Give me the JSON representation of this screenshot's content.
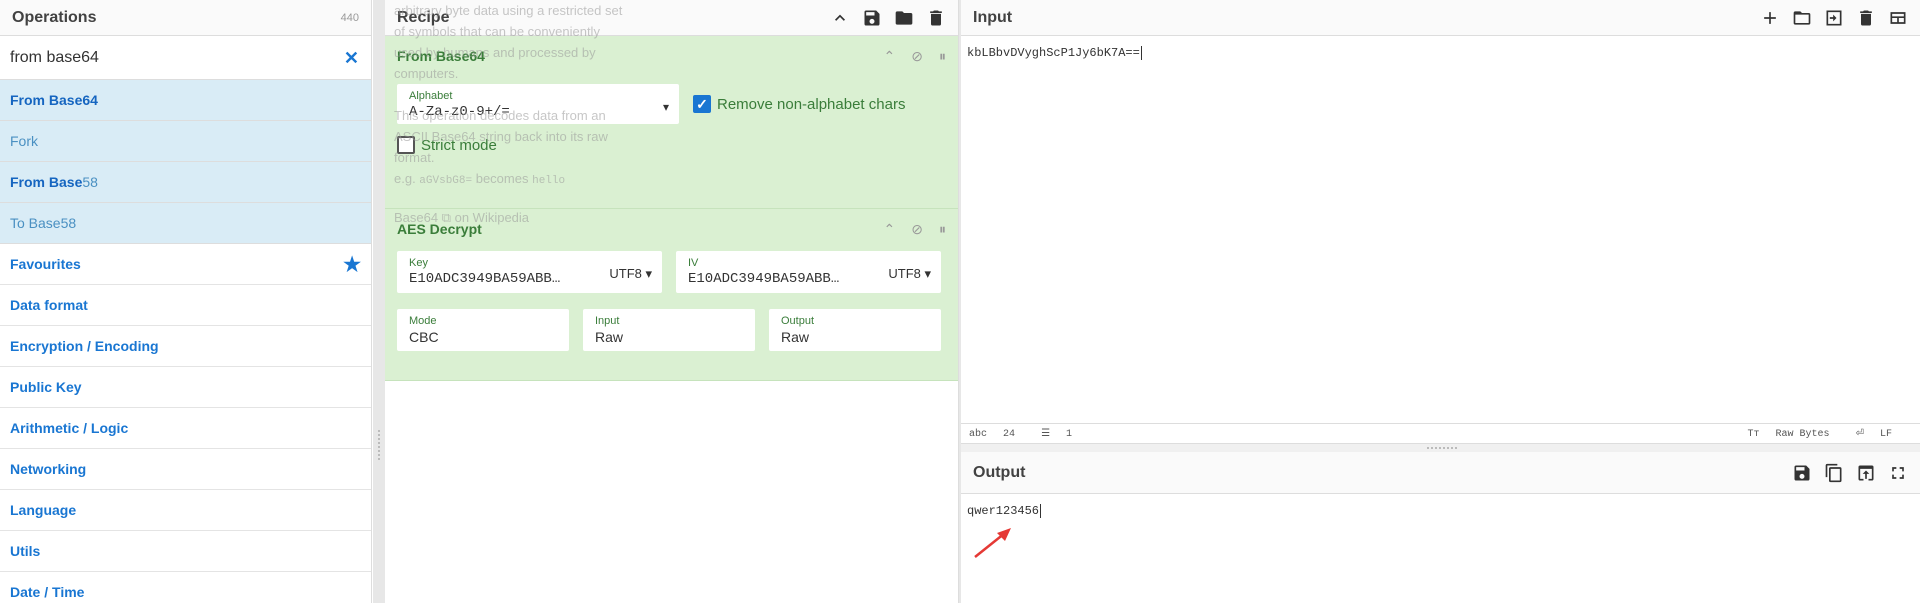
{
  "operations": {
    "title": "Operations",
    "count": "440",
    "search_value": "from base64",
    "results": [
      {
        "bold": "From Base64",
        "rest": ""
      },
      {
        "bold": "",
        "rest": "Fork"
      },
      {
        "bold": "From Base",
        "rest": "58"
      },
      {
        "bold": "",
        "rest": "To Base58"
      }
    ],
    "categories": [
      "Favourites",
      "Data format",
      "Encryption / Encoding",
      "Public Key",
      "Arithmetic / Logic",
      "Networking",
      "Language",
      "Utils",
      "Date / Time"
    ]
  },
  "recipe": {
    "title": "Recipe",
    "ghost": {
      "l1": "arbitrary byte data using a restricted set",
      "l2": "of symbols that can be conveniently",
      "l3": "used by humans and processed by",
      "l4": "computers.",
      "l5": "This operation decodes data from an",
      "l6": "ASCII Base64 string back into its raw",
      "l7": "format.",
      "l8a": "e.g. ",
      "l8b": "aGVsbG8=",
      "l8c": " becomes ",
      "l8d": "hello",
      "l9": "Base64 ⧉ on Wikipedia"
    },
    "from_base64": {
      "name": "From Base64",
      "alphabet_label": "Alphabet",
      "alphabet_value": "A-Za-z0-9+/=",
      "remove_label": "Remove non-alphabet chars",
      "strict_label": "Strict mode"
    },
    "aes": {
      "name": "AES Decrypt",
      "key_label": "Key",
      "key_value": "E10ADC3949BA59ABB…",
      "key_enc": "UTF8",
      "iv_label": "IV",
      "iv_value": "E10ADC3949BA59ABB…",
      "iv_enc": "UTF8",
      "mode_label": "Mode",
      "mode_value": "CBC",
      "input_label": "Input",
      "input_value": "Raw",
      "output_label": "Output",
      "output_value": "Raw"
    }
  },
  "input": {
    "title": "Input",
    "value": "kbLBbvDVyghScP1Jy6bK7A==",
    "status_chars_label": "abc",
    "status_chars": "24",
    "status_lines": "1",
    "status_right1": "Raw Bytes",
    "status_right2": "LF"
  },
  "output": {
    "title": "Output",
    "value": "qwer123456"
  },
  "colors": {
    "accent": "#1976d2",
    "recipe_green": "#daf0d2",
    "arrow_red": "#e53935"
  }
}
